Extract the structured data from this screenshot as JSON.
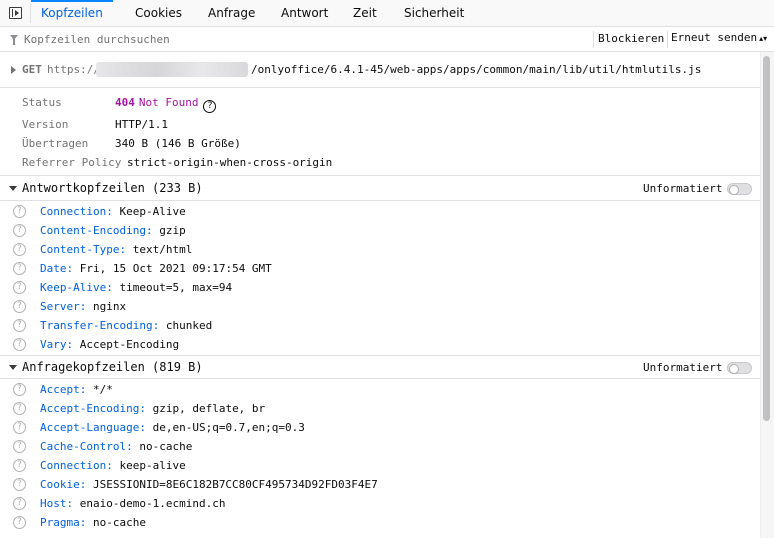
{
  "tabs": [
    {
      "label": "Kopfzeilen",
      "active": true
    },
    {
      "label": "Cookies",
      "active": false
    },
    {
      "label": "Anfrage",
      "active": false
    },
    {
      "label": "Antwort",
      "active": false
    },
    {
      "label": "Zeit",
      "active": false
    },
    {
      "label": "Sicherheit",
      "active": false
    }
  ],
  "filter": {
    "placeholder": "Kopfzeilen durchsuchen",
    "block_label": "Blockieren",
    "resend_label": "Erneut senden",
    "resend_arrows": "▴▾"
  },
  "request": {
    "method": "GET",
    "scheme": "https://",
    "path": "/onlyoffice/6.4.1-45/web-apps/apps/common/main/lib/util/htmlutils.js"
  },
  "summary": {
    "status_label": "Status",
    "status_code": "404",
    "status_text": "Not Found",
    "help_glyph": "?",
    "version_label": "Version",
    "version_value": "HTTP/1.1",
    "transferred_label": "Übertragen",
    "transferred_value": "340 B (146 B Größe)",
    "referrer_label": "Referrer Policy",
    "referrer_value": "strict-origin-when-cross-origin"
  },
  "response_headers": {
    "title": "Antwortkopfzeilen (233 B)",
    "raw_label": "Unformatiert",
    "items": [
      {
        "name": "Connection:",
        "value": "Keep-Alive"
      },
      {
        "name": "Content-Encoding:",
        "value": "gzip"
      },
      {
        "name": "Content-Type:",
        "value": "text/html"
      },
      {
        "name": "Date:",
        "value": "Fri, 15 Oct 2021 09:17:54 GMT"
      },
      {
        "name": "Keep-Alive:",
        "value": "timeout=5, max=94"
      },
      {
        "name": "Server:",
        "value": "nginx"
      },
      {
        "name": "Transfer-Encoding:",
        "value": "chunked"
      },
      {
        "name": "Vary:",
        "value": "Accept-Encoding"
      }
    ]
  },
  "request_headers": {
    "title": "Anfragekopfzeilen (819 B)",
    "raw_label": "Unformatiert",
    "items": [
      {
        "name": "Accept:",
        "value": "*/*"
      },
      {
        "name": "Accept-Encoding:",
        "value": "gzip, deflate, br"
      },
      {
        "name": "Accept-Language:",
        "value": "de,en-US;q=0.7,en;q=0.3"
      },
      {
        "name": "Cache-Control:",
        "value": "no-cache"
      },
      {
        "name": "Connection:",
        "value": "keep-alive"
      },
      {
        "name": "Cookie:",
        "value": "JSESSIONID=8E6C182B7CC80CF495734D92FD03F4E7"
      },
      {
        "name": "Host:",
        "value": "enaio-demo-1.ecmind.ch"
      },
      {
        "name": "Pragma:",
        "value": "no-cache"
      }
    ]
  },
  "colors": {
    "accent": "#0060df",
    "status": "#a214a2",
    "border": "#e0e0e2"
  }
}
